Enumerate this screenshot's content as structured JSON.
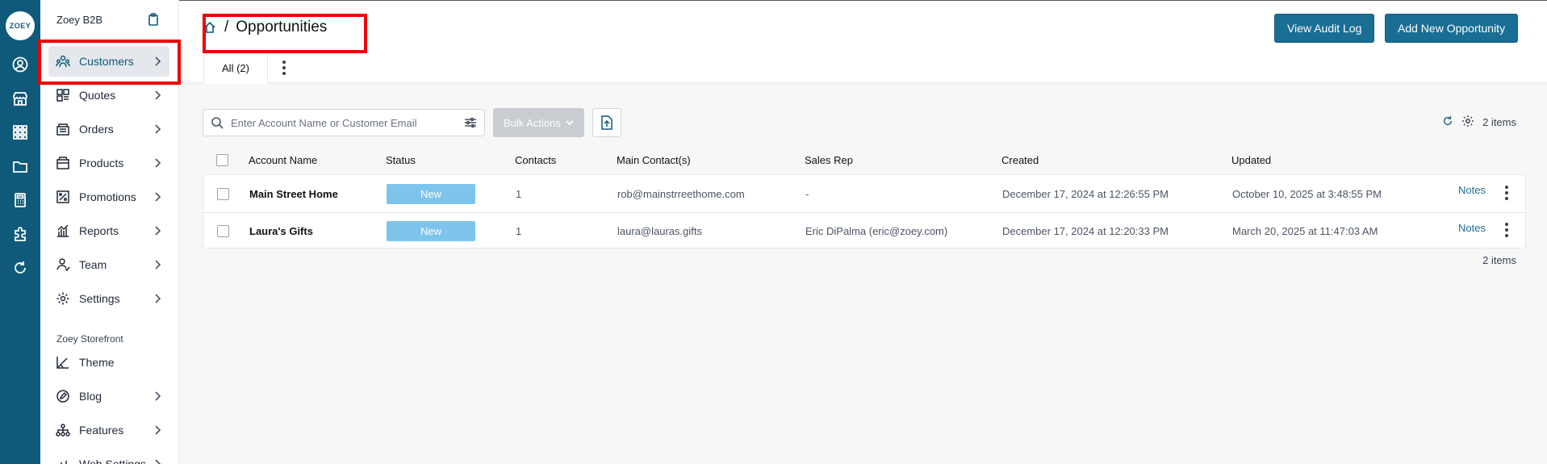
{
  "rail": {
    "logo_text": "ZOEY",
    "icons": [
      "user-circle-icon",
      "store-icon",
      "apps-grid-icon",
      "folder-icon",
      "calculator-icon",
      "puzzle-icon",
      "refresh-icon"
    ]
  },
  "sidebar": {
    "title": "Zoey B2B",
    "items": [
      {
        "label": "Customers",
        "icon": "customers-icon",
        "active": true,
        "chevron": true
      },
      {
        "label": "Quotes",
        "icon": "quotes-icon",
        "chevron": true
      },
      {
        "label": "Orders",
        "icon": "orders-icon",
        "chevron": true
      },
      {
        "label": "Products",
        "icon": "products-icon",
        "chevron": true
      },
      {
        "label": "Promotions",
        "icon": "promotions-icon",
        "chevron": true
      },
      {
        "label": "Reports",
        "icon": "reports-icon",
        "chevron": true
      },
      {
        "label": "Team",
        "icon": "team-icon",
        "chevron": true
      },
      {
        "label": "Settings",
        "icon": "settings-icon",
        "chevron": true
      }
    ],
    "section_title": "Zoey Storefront",
    "storefront_items": [
      {
        "label": "Theme",
        "icon": "theme-icon",
        "chevron": false
      },
      {
        "label": "Blog",
        "icon": "blog-icon",
        "chevron": true
      },
      {
        "label": "Features",
        "icon": "features-icon",
        "chevron": true
      },
      {
        "label": "Web Settings",
        "icon": "web-settings-icon",
        "chevron": true
      }
    ]
  },
  "header": {
    "breadcrumb_sep": "/",
    "title": "Opportunities",
    "view_audit_label": "View Audit Log",
    "add_new_label": "Add New Opportunity",
    "tab_all": "All (2)"
  },
  "toolbar": {
    "search_placeholder": "Enter Account Name or Customer Email",
    "bulk_label": "Bulk Actions",
    "count_label": "2 items"
  },
  "table": {
    "columns": [
      "Account Name",
      "Status",
      "Contacts",
      "Main Contact(s)",
      "Sales Rep",
      "Created",
      "Updated"
    ],
    "rows": [
      {
        "account": "Main Street Home",
        "status": "New",
        "contacts": "1",
        "main_contact": "rob@mainstrreethome.com",
        "sales_rep": "-",
        "created": "December 17, 2024 at 12:26:55 PM",
        "updated": "October 10, 2025 at 3:48:55 PM",
        "notes": "Notes"
      },
      {
        "account": "Laura's Gifts",
        "status": "New",
        "contacts": "1",
        "main_contact": "laura@lauras.gifts",
        "sales_rep": "Eric DiPalma (eric@zoey.com)",
        "created": "December 17, 2024 at 12:20:33 PM",
        "updated": "March 20, 2025 at 11:47:03 AM",
        "notes": "Notes"
      }
    ],
    "footer_count": "2 items"
  },
  "colors": {
    "rail": "#0f5a7a",
    "primary_button": "#1a6e94",
    "status_new": "#7dc5ec",
    "highlight": "#ee0000"
  }
}
